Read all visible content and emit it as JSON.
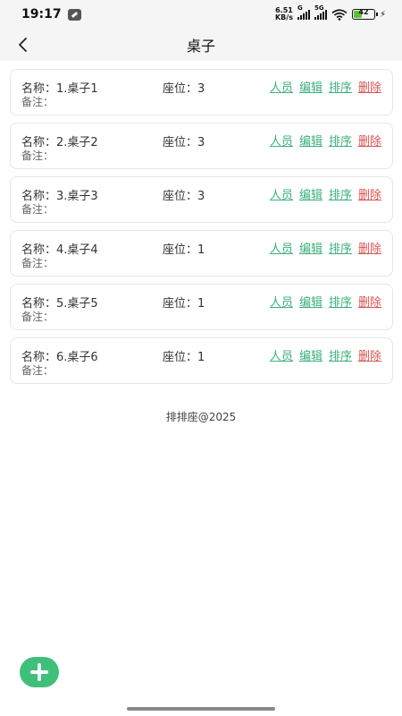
{
  "status_bar": {
    "time": "19:17",
    "net_speed_value": "6.51",
    "net_speed_unit": "KB/s",
    "signal1_label": "G",
    "signal2_label": "5G",
    "battery": "42"
  },
  "header": {
    "title": "桌子"
  },
  "tables": [
    {
      "name": "名称：1.桌子1",
      "seats": "座位：3",
      "note": "备注："
    },
    {
      "name": "名称：2.桌子2",
      "seats": "座位：3",
      "note": "备注："
    },
    {
      "name": "名称：3.桌子3",
      "seats": "座位：3",
      "note": "备注："
    },
    {
      "name": "名称：4.桌子4",
      "seats": "座位：1",
      "note": "备注："
    },
    {
      "name": "名称：5.桌子5",
      "seats": "座位：1",
      "note": "备注："
    },
    {
      "name": "名称：6.桌子6",
      "seats": "座位：1",
      "note": "备注："
    }
  ],
  "actions": {
    "members": "人员",
    "edit": "编辑",
    "sort": "排序",
    "delete": "删除"
  },
  "footer": {
    "text": "排排座@2025"
  },
  "colors": {
    "accent": "#3bb07c",
    "danger": "#d9534f",
    "fab": "#3fbf7a"
  }
}
